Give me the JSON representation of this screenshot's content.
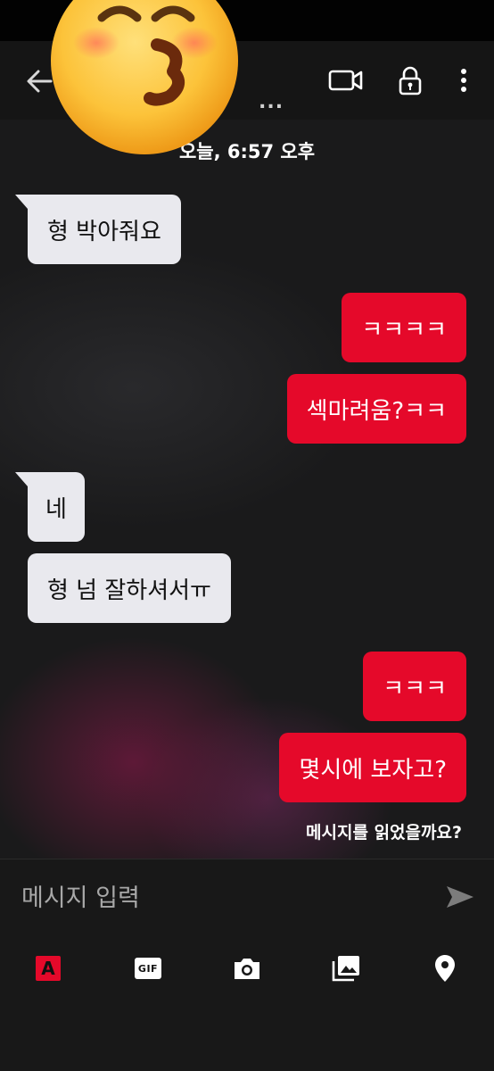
{
  "header": {
    "title_truncated": "...",
    "back_icon": "arrow-left-icon",
    "video_icon": "video-call-icon",
    "lock_icon": "lock-icon",
    "more_icon": "more-vertical-icon"
  },
  "overlay": {
    "emoji": "kissing-face-emoji"
  },
  "chat": {
    "timestamp": "오늘, 6:57 오후",
    "messages": [
      {
        "side": "incoming",
        "text": "형 박아줘요"
      },
      {
        "side": "outgoing",
        "text": "ㅋㅋㅋㅋ"
      },
      {
        "side": "outgoing",
        "text": "섹마려움?ㅋㅋ"
      },
      {
        "side": "incoming",
        "text": "네"
      },
      {
        "side": "incoming",
        "text": "형 넘 잘하셔서ㅠ"
      },
      {
        "side": "outgoing",
        "text": "ㅋㅋㅋ"
      },
      {
        "side": "outgoing",
        "text": "몇시에 보자고?"
      }
    ],
    "read_receipt": "메시지를 읽었을까요?"
  },
  "composer": {
    "placeholder": "메시지 입력",
    "value": "",
    "send_icon": "send-icon",
    "tools": {
      "text_style_label": "A",
      "gif_label": "GIF",
      "camera_icon": "camera-icon",
      "gallery_icon": "gallery-icon",
      "location_icon": "location-pin-icon"
    }
  },
  "colors": {
    "accent": "#e5092a",
    "incoming_bubble": "#e9e9ee",
    "background": "#1a1a1b"
  }
}
